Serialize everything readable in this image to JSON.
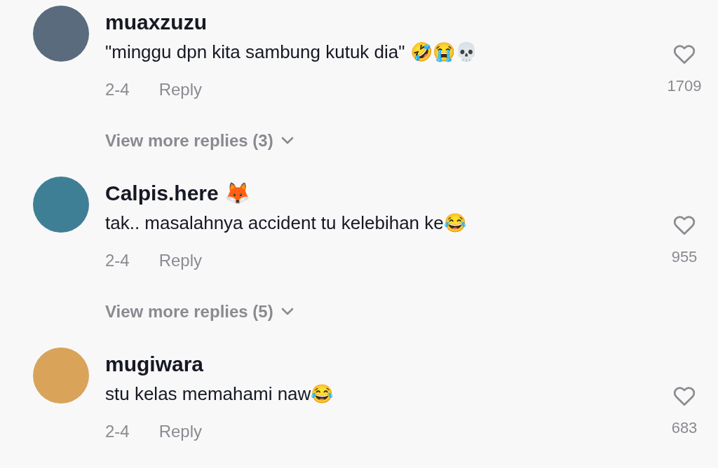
{
  "comments": [
    {
      "username": "muaxzuzu",
      "text": "\"minggu dpn kita sambung kutuk dia\" 🤣😭💀",
      "date": "2-4",
      "reply": "Reply",
      "likes": "1709",
      "liked": false,
      "more_replies": "View more replies (3)"
    },
    {
      "username": "Calpis.here 🦊",
      "text": "tak.. masalahnya accident tu kelebihan ke😂",
      "date": "2-4",
      "reply": "Reply",
      "likes": "955",
      "liked": false,
      "more_replies": "View more replies (5)"
    },
    {
      "username": "mugiwara",
      "text": "stu kelas memahami naw😂",
      "date": "2-4",
      "reply": "Reply",
      "likes": "683",
      "liked": false
    }
  ]
}
